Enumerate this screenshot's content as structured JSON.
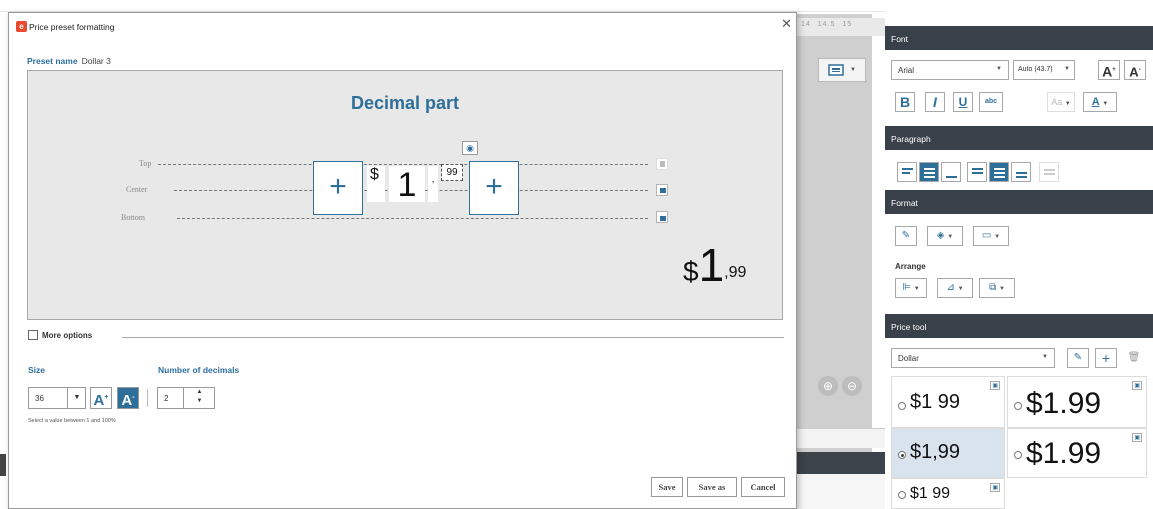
{
  "dialog": {
    "title": "Price preset formatting",
    "preset_name_label": "Preset name",
    "preset_name_value": "Dollar 3",
    "heading": "Decimal part",
    "guides": {
      "top": "Top",
      "center": "Center",
      "bottom": "Bottom"
    },
    "preview_parts": {
      "currency": "$",
      "integer": "1",
      "separator": ",",
      "decimals": "99"
    },
    "preview_result": {
      "currency": "$",
      "integer": "1",
      "separator": ",",
      "decimals": "99"
    },
    "more_options": "More options",
    "size_label": "Size",
    "size_value": "36",
    "decimals_label": "Number of decimals",
    "decimals_value": "2",
    "hint": "Select a value between 1 and 100%",
    "save": "Save",
    "save_as": "Save as",
    "cancel": "Cancel"
  },
  "ruler": [
    "14",
    "14.5",
    "15"
  ],
  "panel": {
    "font_header": "Font",
    "font_name": "Arial",
    "font_size": "Auto (43.7)",
    "bold": "B",
    "italic": "I",
    "underline": "U",
    "strike": "abc",
    "case": "Aa",
    "color_letter": "A",
    "paragraph_header": "Paragraph",
    "format_header": "Format",
    "arrange_label": "Arrange",
    "price_tool_header": "Price tool",
    "price_select": "Dollar",
    "tiles": [
      {
        "text": "$1 99",
        "selected": false
      },
      {
        "text": "$1.99",
        "selected": false
      },
      {
        "text": "$1,99",
        "selected": true
      },
      {
        "text": "$1.99",
        "selected": false
      },
      {
        "text": "$1 99",
        "selected": false
      }
    ]
  },
  "colors": {
    "accent": "#2e6f9a",
    "header_bg": "#3a4049",
    "brand": "#e84a2f"
  }
}
